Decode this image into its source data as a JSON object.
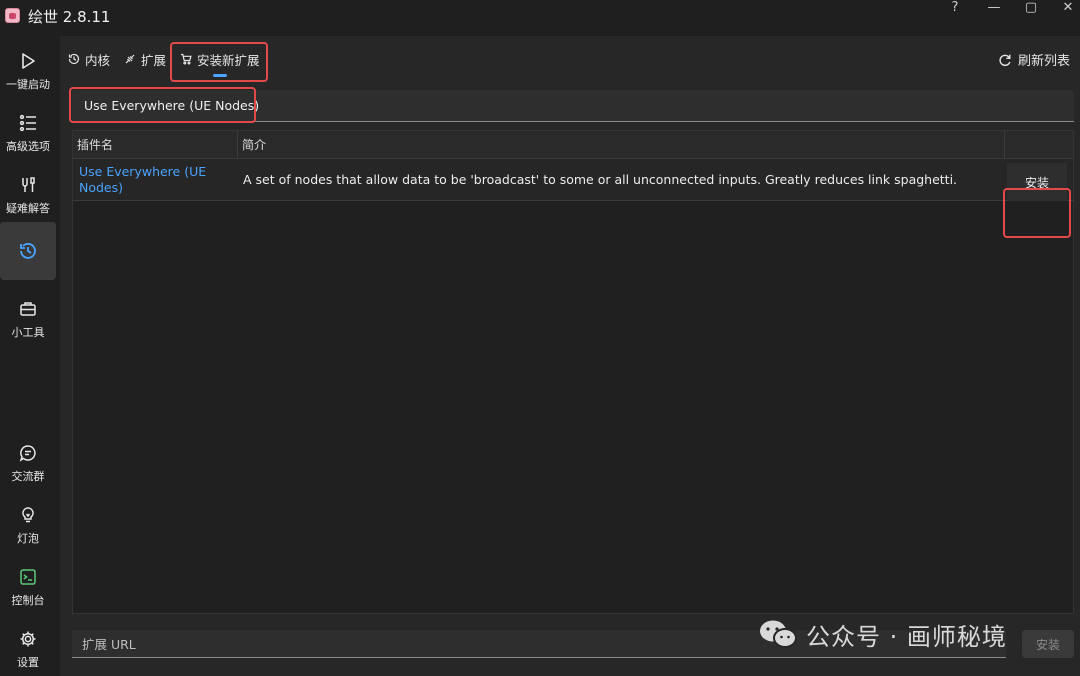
{
  "app": {
    "title": "绘世 2.8.11"
  },
  "window_controls": {
    "help": "?",
    "minimize": "—",
    "maximize": "▢",
    "close": "✕"
  },
  "sidebar": {
    "items": [
      {
        "label": "一键启动",
        "icon": "play-icon"
      },
      {
        "label": "高级选项",
        "icon": "list-icon"
      },
      {
        "label": "疑难解答",
        "icon": "tools-icon"
      },
      {
        "label": "",
        "icon": "history-icon",
        "active": true
      },
      {
        "label": "小工具",
        "icon": "toolbox-icon"
      },
      {
        "label": "交流群",
        "icon": "chat-icon"
      },
      {
        "label": "灯泡",
        "icon": "bulb-icon"
      },
      {
        "label": "控制台",
        "icon": "terminal-icon"
      },
      {
        "label": "设置",
        "icon": "gear-icon"
      }
    ]
  },
  "tabs": [
    {
      "label": "内核",
      "icon": "history-icon"
    },
    {
      "label": "扩展",
      "icon": "plug-icon"
    },
    {
      "label": "安装新扩展",
      "icon": "cart-icon",
      "active": true
    }
  ],
  "refresh_label": "刷新列表",
  "search": {
    "value": "Use Everywhere (UE Nodes)"
  },
  "table": {
    "columns": [
      "插件名",
      "简介"
    ],
    "rows": [
      {
        "name": "Use Everywhere (UE Nodes)",
        "description": "A set of nodes that allow data to be 'broadcast' to some or all unconnected inputs. Greatly reduces link spaghetti.",
        "action": "安装"
      }
    ]
  },
  "url_field": {
    "placeholder": "扩展 URL",
    "button": "安装"
  },
  "watermark": {
    "text": "公众号 · 画师秘境"
  },
  "colors": {
    "accent": "#4aa3ff",
    "highlight": "#e24a4a",
    "background": "#1f1f1f",
    "panel": "#272727"
  }
}
